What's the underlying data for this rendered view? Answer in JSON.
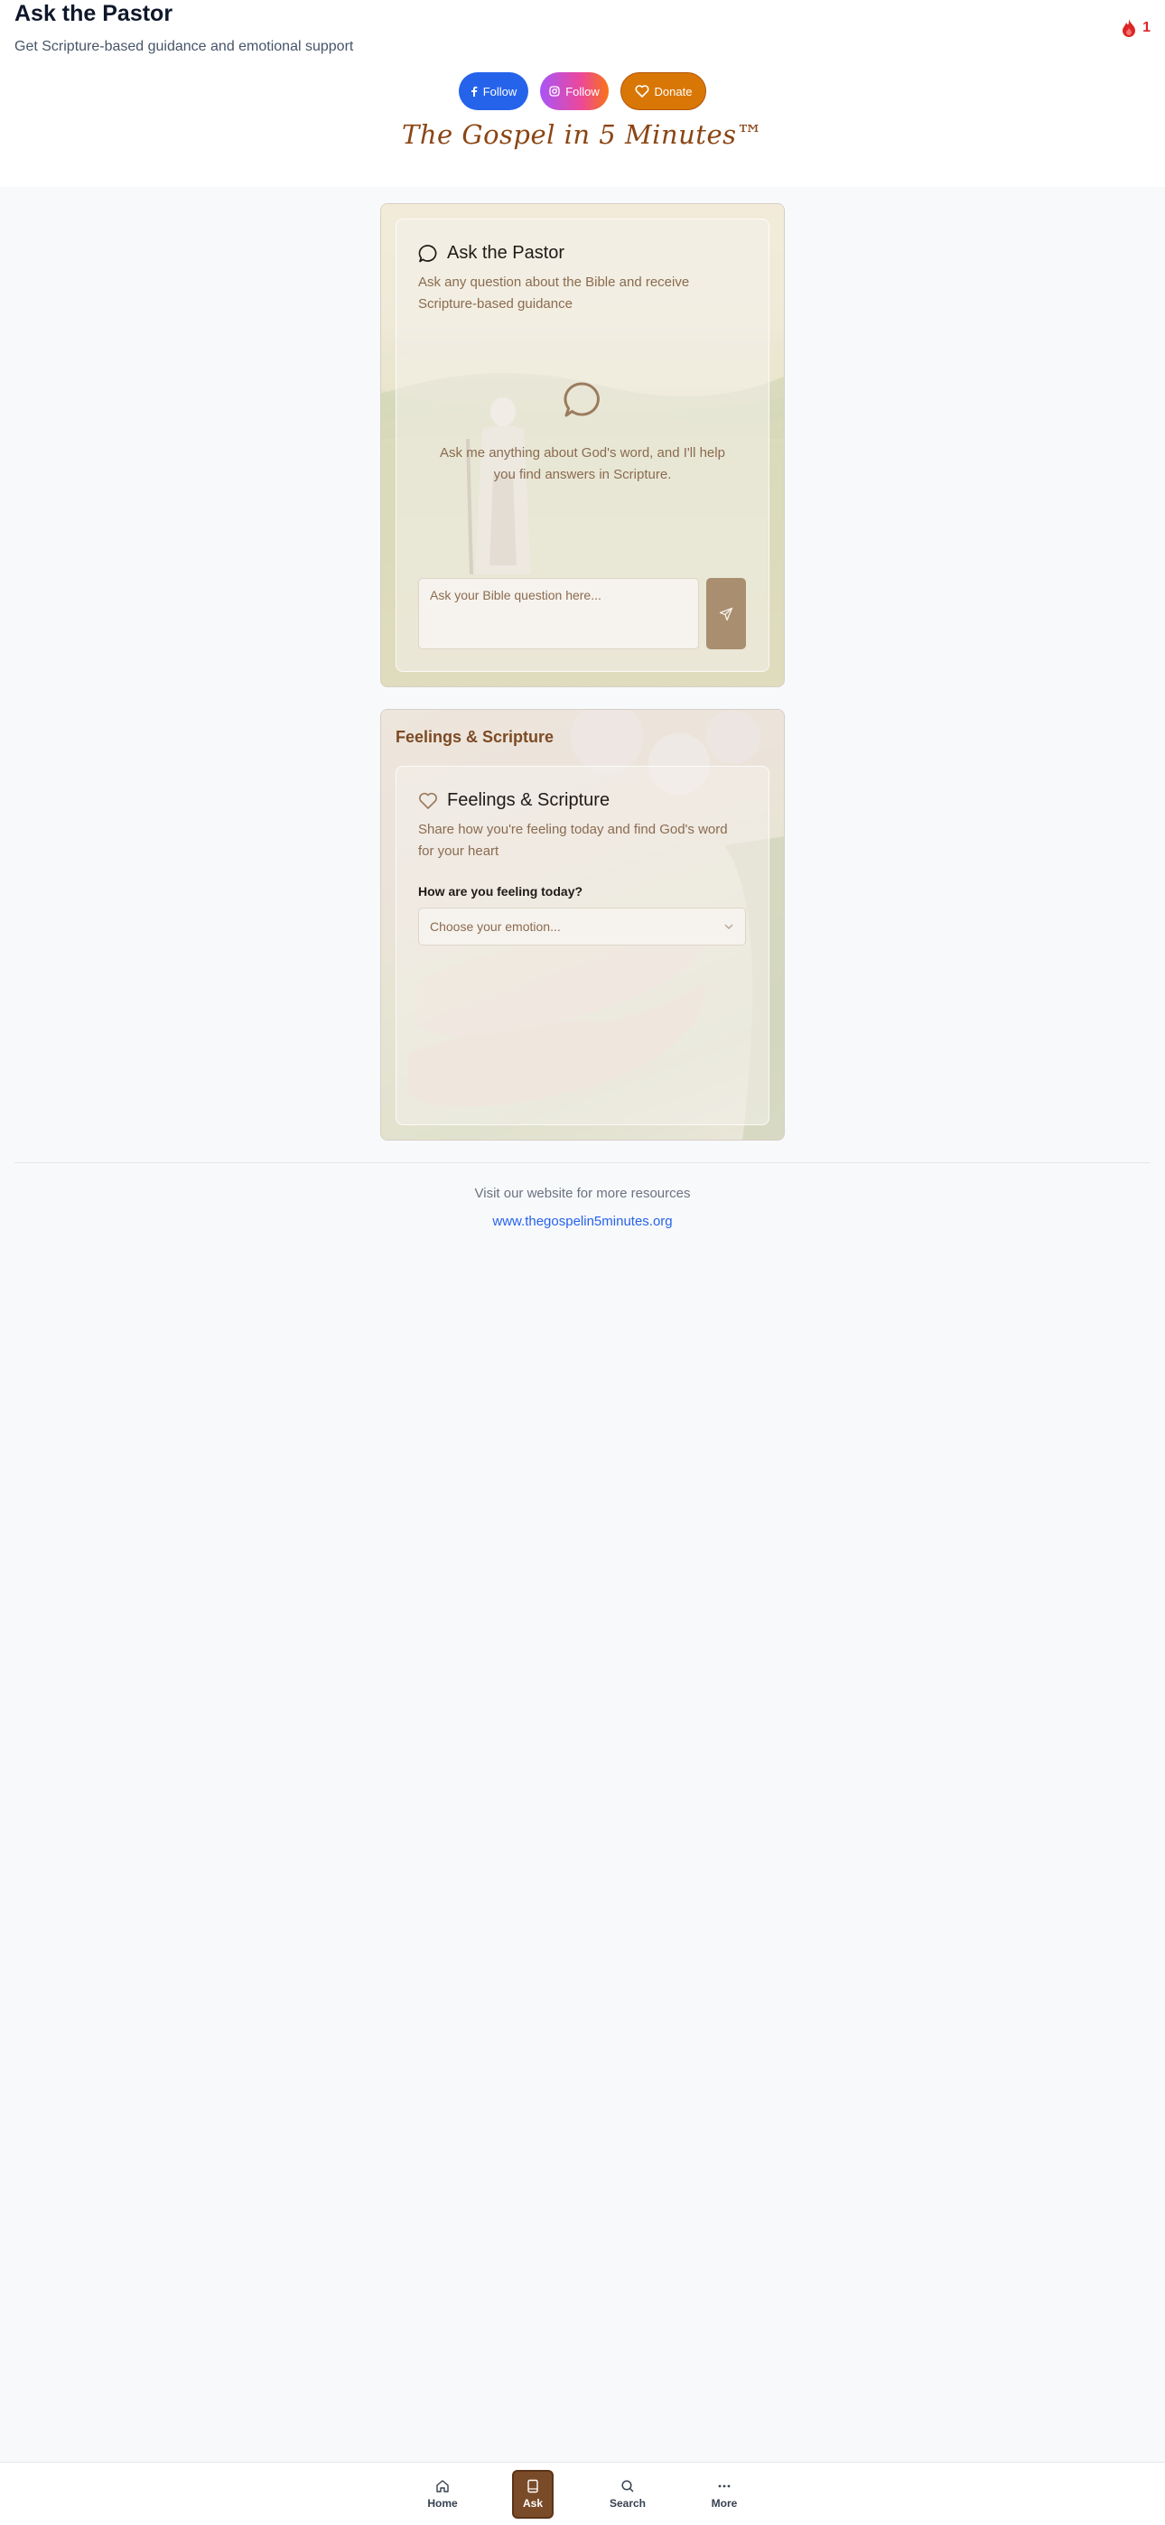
{
  "header": {
    "title": "Ask the Pastor",
    "subtitle": "Get Scripture-based guidance and emotional support",
    "streak_count": "1",
    "facebook_label": "Follow",
    "instagram_label": "Follow",
    "donate_label": "Donate",
    "brand": "The Gospel in 5 Minutes™"
  },
  "ask_card": {
    "title": "Ask the Pastor",
    "description": "Ask any question about the Bible and receive Scripture-based guidance",
    "empty_message": "Ask me anything about God's word, and I'll help you find answers in Scripture.",
    "input_placeholder": "Ask your Bible question here...",
    "input_value": ""
  },
  "feelings_card": {
    "heading": "Feelings & Scripture",
    "title": "Feelings & Scripture",
    "description": "Share how you're feeling today and find God's word for your heart",
    "field_label": "How are you feeling today?",
    "select_value": "Choose your emotion..."
  },
  "footer": {
    "visit_text": "Visit our website for more resources",
    "link_text": "www.thegospelin5minutes.org"
  },
  "bottom_nav": {
    "items": [
      {
        "label": "Home",
        "icon": "home-icon"
      },
      {
        "label": "Ask",
        "icon": "book-icon",
        "active": true
      },
      {
        "label": "Search",
        "icon": "search-icon"
      },
      {
        "label": "More",
        "icon": "more-icon"
      }
    ]
  },
  "colors": {
    "accent_brown": "#7a4b28",
    "facebook_blue": "#2563eb",
    "donate_orange": "#d97706",
    "streak_red": "#dc2626",
    "link_blue": "#2563eb"
  }
}
